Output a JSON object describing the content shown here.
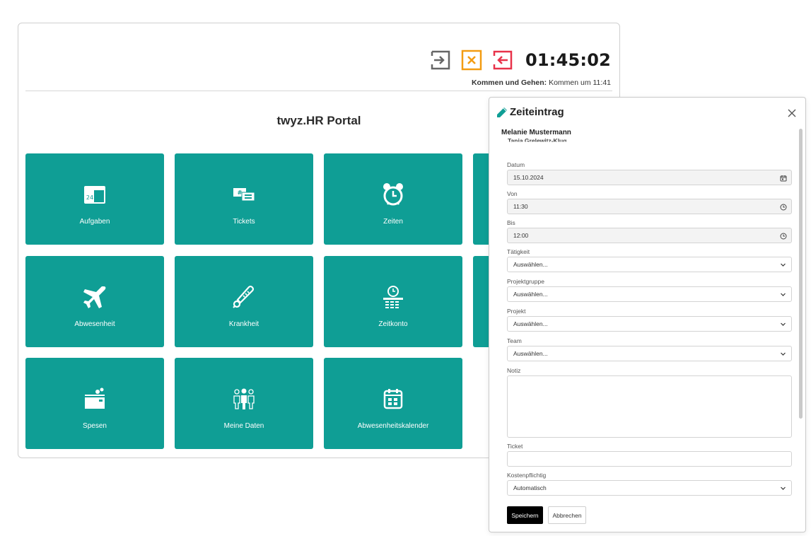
{
  "portal": {
    "clock": "01:45:02",
    "kommen_label": "Kommen und Gehen:",
    "kommen_value": "Kommen um 11:41",
    "title": "twyz.HR Portal",
    "tiles": [
      {
        "label": "Aufgaben",
        "icon": "calendar-24-icon"
      },
      {
        "label": "Tickets",
        "icon": "tickets-icon"
      },
      {
        "label": "Zeiten",
        "icon": "alarm-clock-icon"
      },
      {
        "label": "Abwesenheit",
        "icon": "airplane-icon"
      },
      {
        "label": "Krankheit",
        "icon": "thermometer-icon"
      },
      {
        "label": "Zeitkonto",
        "icon": "time-account-icon"
      },
      {
        "label": "Spesen",
        "icon": "wallet-coins-icon"
      },
      {
        "label": "Meine Daten",
        "icon": "people-icon"
      },
      {
        "label": "Abwesenheitskalender",
        "icon": "calendar-icon"
      }
    ],
    "colors": {
      "tile": "#0f9e95",
      "kommen_icon": "#666666",
      "cancel_icon": "#f39c12",
      "gehen_icon": "#e8324a"
    }
  },
  "modal": {
    "title": "Zeiteintrag",
    "user": "Melanie Mustermann",
    "user_secondary": "Tanja Grelewitz-Klug",
    "fields": {
      "datum": {
        "label": "Datum",
        "value": "15.10.2024"
      },
      "von": {
        "label": "Von",
        "value": "11:30"
      },
      "bis": {
        "label": "Bis",
        "value": "12:00"
      },
      "taetigkeit": {
        "label": "Tätigkeit",
        "value": "Auswählen..."
      },
      "projektgruppe": {
        "label": "Projektgruppe",
        "value": "Auswählen..."
      },
      "projekt": {
        "label": "Projekt",
        "value": "Auswählen..."
      },
      "team": {
        "label": "Team",
        "value": "Auswählen..."
      },
      "notiz": {
        "label": "Notiz",
        "value": ""
      },
      "ticket": {
        "label": "Ticket",
        "value": ""
      },
      "kostenpflichtig": {
        "label": "Kostenpflichtig",
        "value": "Automatisch"
      }
    },
    "save_label": "Speichern",
    "cancel_label": "Abbrechen",
    "colors": {
      "accent": "#0f9e95"
    }
  }
}
